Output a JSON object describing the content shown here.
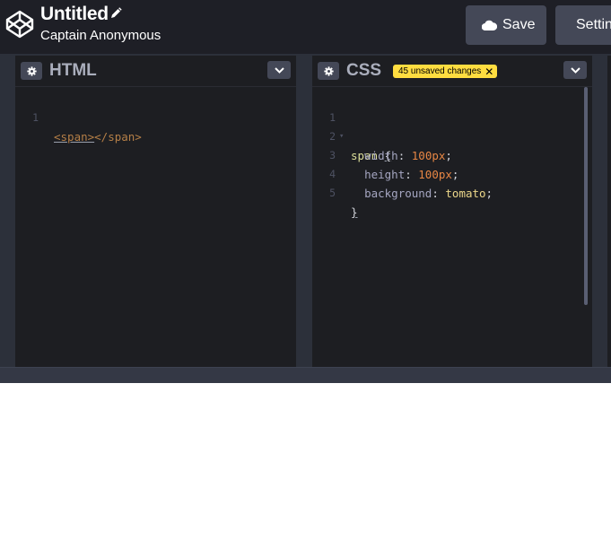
{
  "header": {
    "title": "Untitled",
    "author": "Captain Anonymous",
    "save_label": "Save",
    "settings_label": "Settings"
  },
  "html_pane": {
    "title": "HTML",
    "lines": [
      {
        "num": "1",
        "open": "<span>",
        "close": "</span>"
      }
    ]
  },
  "css_pane": {
    "title": "CSS",
    "badge": "45 unsaved changes",
    "lines": [
      {
        "num": "1"
      },
      {
        "num": "2",
        "prop": "width",
        "value": "100px"
      },
      {
        "num": "3",
        "prop": "height",
        "value": "100px"
      },
      {
        "num": "4",
        "prop": "background",
        "value": "tomato"
      },
      {
        "num": "5"
      }
    ],
    "selector": "span",
    "open_brace": "{",
    "close_brace": "}"
  },
  "colors": {
    "header_bg": "#1e1f26",
    "button_bg": "#444857",
    "editor_bg": "#1d1e22",
    "badge_bg": "#ffdd40"
  },
  "icons": [
    "codepen-logo-icon",
    "pencil-icon",
    "cloud-icon",
    "gear-icon",
    "chevron-down-icon",
    "close-icon"
  ]
}
